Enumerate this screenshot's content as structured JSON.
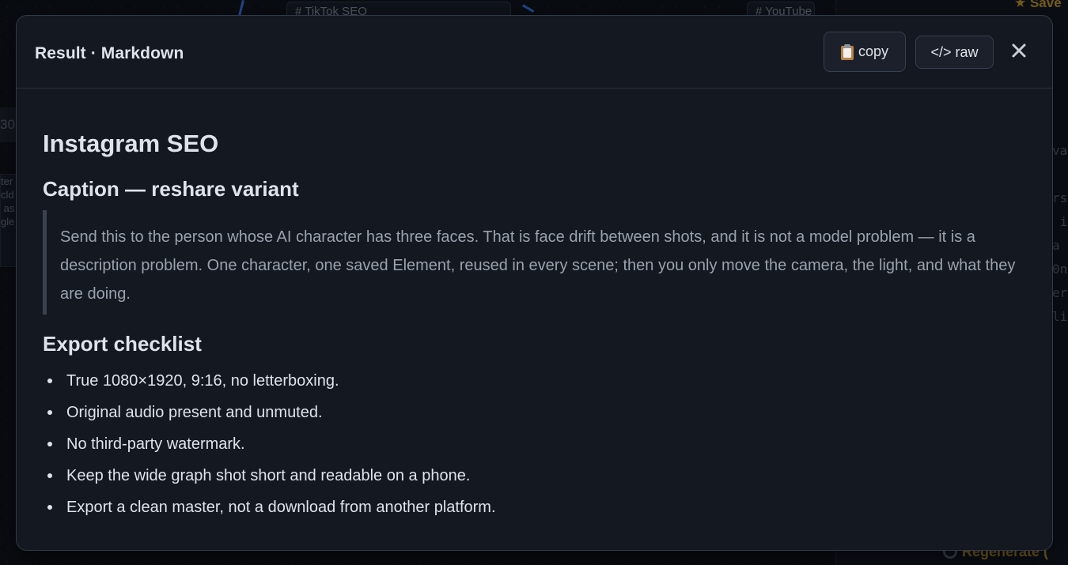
{
  "background": {
    "tags": [
      "# TikTok SEO",
      "# YouTube"
    ],
    "save_label": "★ Save",
    "left_number": "30",
    "left_card_text": "ter\ncld\n as\ngle",
    "code_fragments": "va\n\nrs\n i\na\n0n\ner\nli",
    "regenerate_label": "Regenerate ("
  },
  "modal": {
    "title": "Result · Markdown",
    "copy_label": "copy",
    "raw_label": "</> raw",
    "close_label": "×"
  },
  "content": {
    "heading": "Instagram SEO",
    "caption_heading": "Caption — reshare variant",
    "caption_text": "Send this to the person whose AI character has three faces. That is face drift between shots, and it is not a model problem — it is a description problem. One character, one saved Element, reused in every scene; then you only move the camera, the light, and what they are doing.",
    "checklist_heading": "Export checklist",
    "checklist": [
      "True 1080×1920, 9:16, no letterboxing.",
      "Original audio present and unmuted.",
      "No third-party watermark.",
      "Keep the wide graph shot short and readable on a phone.",
      "Export a clean master, not a download from another platform."
    ]
  },
  "colors": {
    "modal_bg": "#141821",
    "text": "#dfe3ea",
    "muted_text": "#9aa2ae",
    "accent_gold": "#b58a2a",
    "edge_blue": "#2f6bd6"
  },
  "icons": [
    "clipboard-icon",
    "code-icon",
    "close-icon",
    "star-icon",
    "refresh-icon"
  ]
}
